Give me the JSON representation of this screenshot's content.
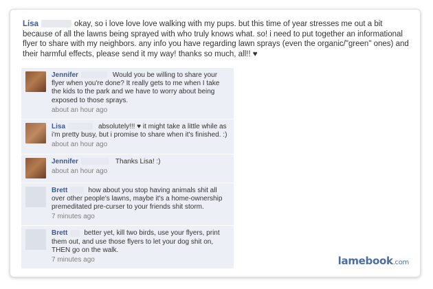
{
  "post": {
    "author": "Lisa",
    "text": "okay, so i love love love walking with my pups. but this time of year stresses me out a bit because of all the lawns being sprayed with who truly knows what. so! i need to put together an informational flyer to share with my neighbors. any info you have regarding lawn sprays (even the organic/\"green\" ones) and their harmful effects, please send it my way! thanks so much, all!! ♥"
  },
  "comments": [
    {
      "author": "Jennifer",
      "text": "Would you be willing to share your flyer when you're done? It really gets to me when I take the kids to the park and we have to worry about being exposed to those sprays.",
      "time": "about an hour ago",
      "avatar": "photo"
    },
    {
      "author": "Lisa",
      "text": "absolutely!!! ♥ it might take a little while as i'm pretty busy, but i promise to share when it's finished. :)",
      "time": "about an hour ago",
      "avatar": "photo"
    },
    {
      "author": "Jennifer",
      "text": "Thanks Lisa! :)",
      "time": "about an hour ago",
      "avatar": "photo"
    },
    {
      "author": "Brett",
      "text": "how about you stop having animals shit all over other people's lawns, maybe it's a home-ownership premeditated pre-curser to your friends shit storm.",
      "time": "7 minutes ago",
      "avatar": "blank"
    },
    {
      "author": "Brett",
      "text": "better yet, kill two birds, use your flyers, print them out, and use those flyers to let your dog shit on, THEN go on the walk.",
      "time": "7 minutes ago",
      "avatar": "blank"
    }
  ],
  "brand": {
    "name": "lamebook",
    "tld": ".com"
  },
  "colors": {
    "link": "#3b5998",
    "comment_bg": "#eceff5",
    "brand": "#4a6fa5"
  }
}
